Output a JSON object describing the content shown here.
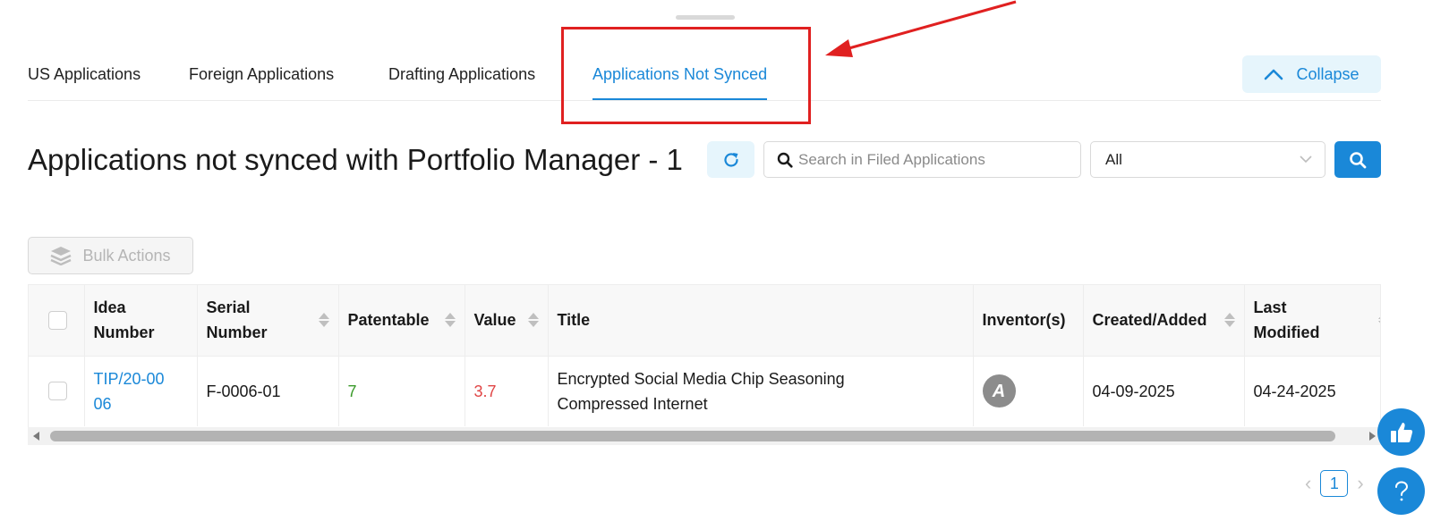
{
  "tabs": [
    {
      "label": "US Applications"
    },
    {
      "label": "Foreign Applications"
    },
    {
      "label": "Drafting Applications"
    },
    {
      "label": "Applications Not Synced",
      "active": true
    }
  ],
  "collapse_label": "Collapse",
  "page_title": "Applications not synced with Portfolio Manager - 1",
  "search": {
    "placeholder": "Search in Filed Applications",
    "value": ""
  },
  "filter_select": {
    "selected": "All"
  },
  "bulk_actions_label": "Bulk Actions",
  "table": {
    "columns": [
      "Idea Number",
      "Serial Number",
      "Patentable",
      "Value",
      "Title",
      "Inventor(s)",
      "Created/Added",
      "Last Modified"
    ],
    "rows": [
      {
        "idea_number": "TIP/20-0006",
        "serial_number": "F-0006-01",
        "patentable": "7",
        "value": "3.7",
        "title": "Encrypted Social Media Chip Seasoning Compressed Internet",
        "inventor_initial": "A",
        "created": "04-09-2025",
        "modified": "04-24-2025"
      }
    ]
  },
  "pagination": {
    "current_page": "1"
  },
  "icons": {
    "collapse": "chevron-up-icon",
    "refresh": "refresh-icon",
    "search": "search-icon",
    "dropdown": "chevron-down-icon",
    "bulk": "layers-icon",
    "feedback": "thumbs-up-icon",
    "help": "question-icon"
  },
  "colors": {
    "accent": "#1a88d8",
    "annotation": "#e02020",
    "patentable": "#3a9a2a",
    "value": "#e04545"
  }
}
